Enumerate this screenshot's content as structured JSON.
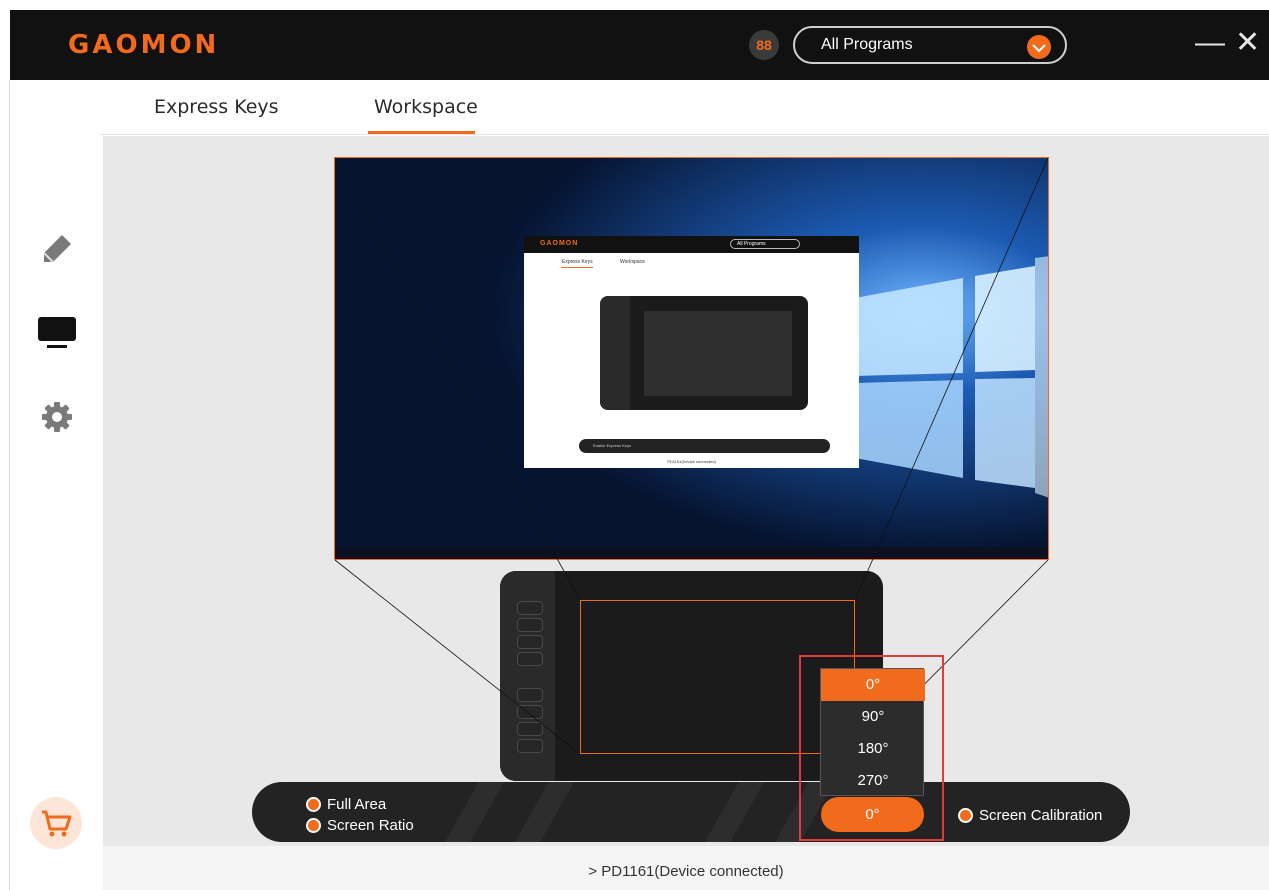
{
  "app": {
    "logo": "GAOMON"
  },
  "header": {
    "program_icon_glyph": "88",
    "program_select_value": "All Programs",
    "minimize_glyph": "—",
    "close_glyph": "✕"
  },
  "tabs": [
    {
      "label": "Express Keys",
      "active": false
    },
    {
      "label": "Workspace",
      "active": true
    }
  ],
  "sidebar": {
    "items": [
      {
        "icon": "pen-icon"
      },
      {
        "icon": "monitor-icon"
      },
      {
        "icon": "gear-icon"
      },
      {
        "icon": "cart-icon"
      }
    ]
  },
  "preview": {
    "mini_logo": "GAOMON",
    "mini_select": "All Programs",
    "mini_tab1": "Express Keys",
    "mini_tab2": "Workspace",
    "mini_enable": "Enable Express Keys",
    "mini_status": "PD1161(Device connected)"
  },
  "mapping": {
    "full_area_label": "Full Area",
    "screen_ratio_label": "Screen Ratio",
    "rotation_value": "0°",
    "rotation_options": [
      "0°",
      "90°",
      "180°",
      "270°"
    ],
    "selected_rotation_index": 0,
    "screen_calibration_label": "Screen Calibration"
  },
  "status": {
    "device_text": "PD1161(Device connected)"
  },
  "colors": {
    "accent": "#f26b1d",
    "titlebar": "#111111",
    "panel": "#e8e8e8",
    "highlight": "#e03c3c"
  }
}
